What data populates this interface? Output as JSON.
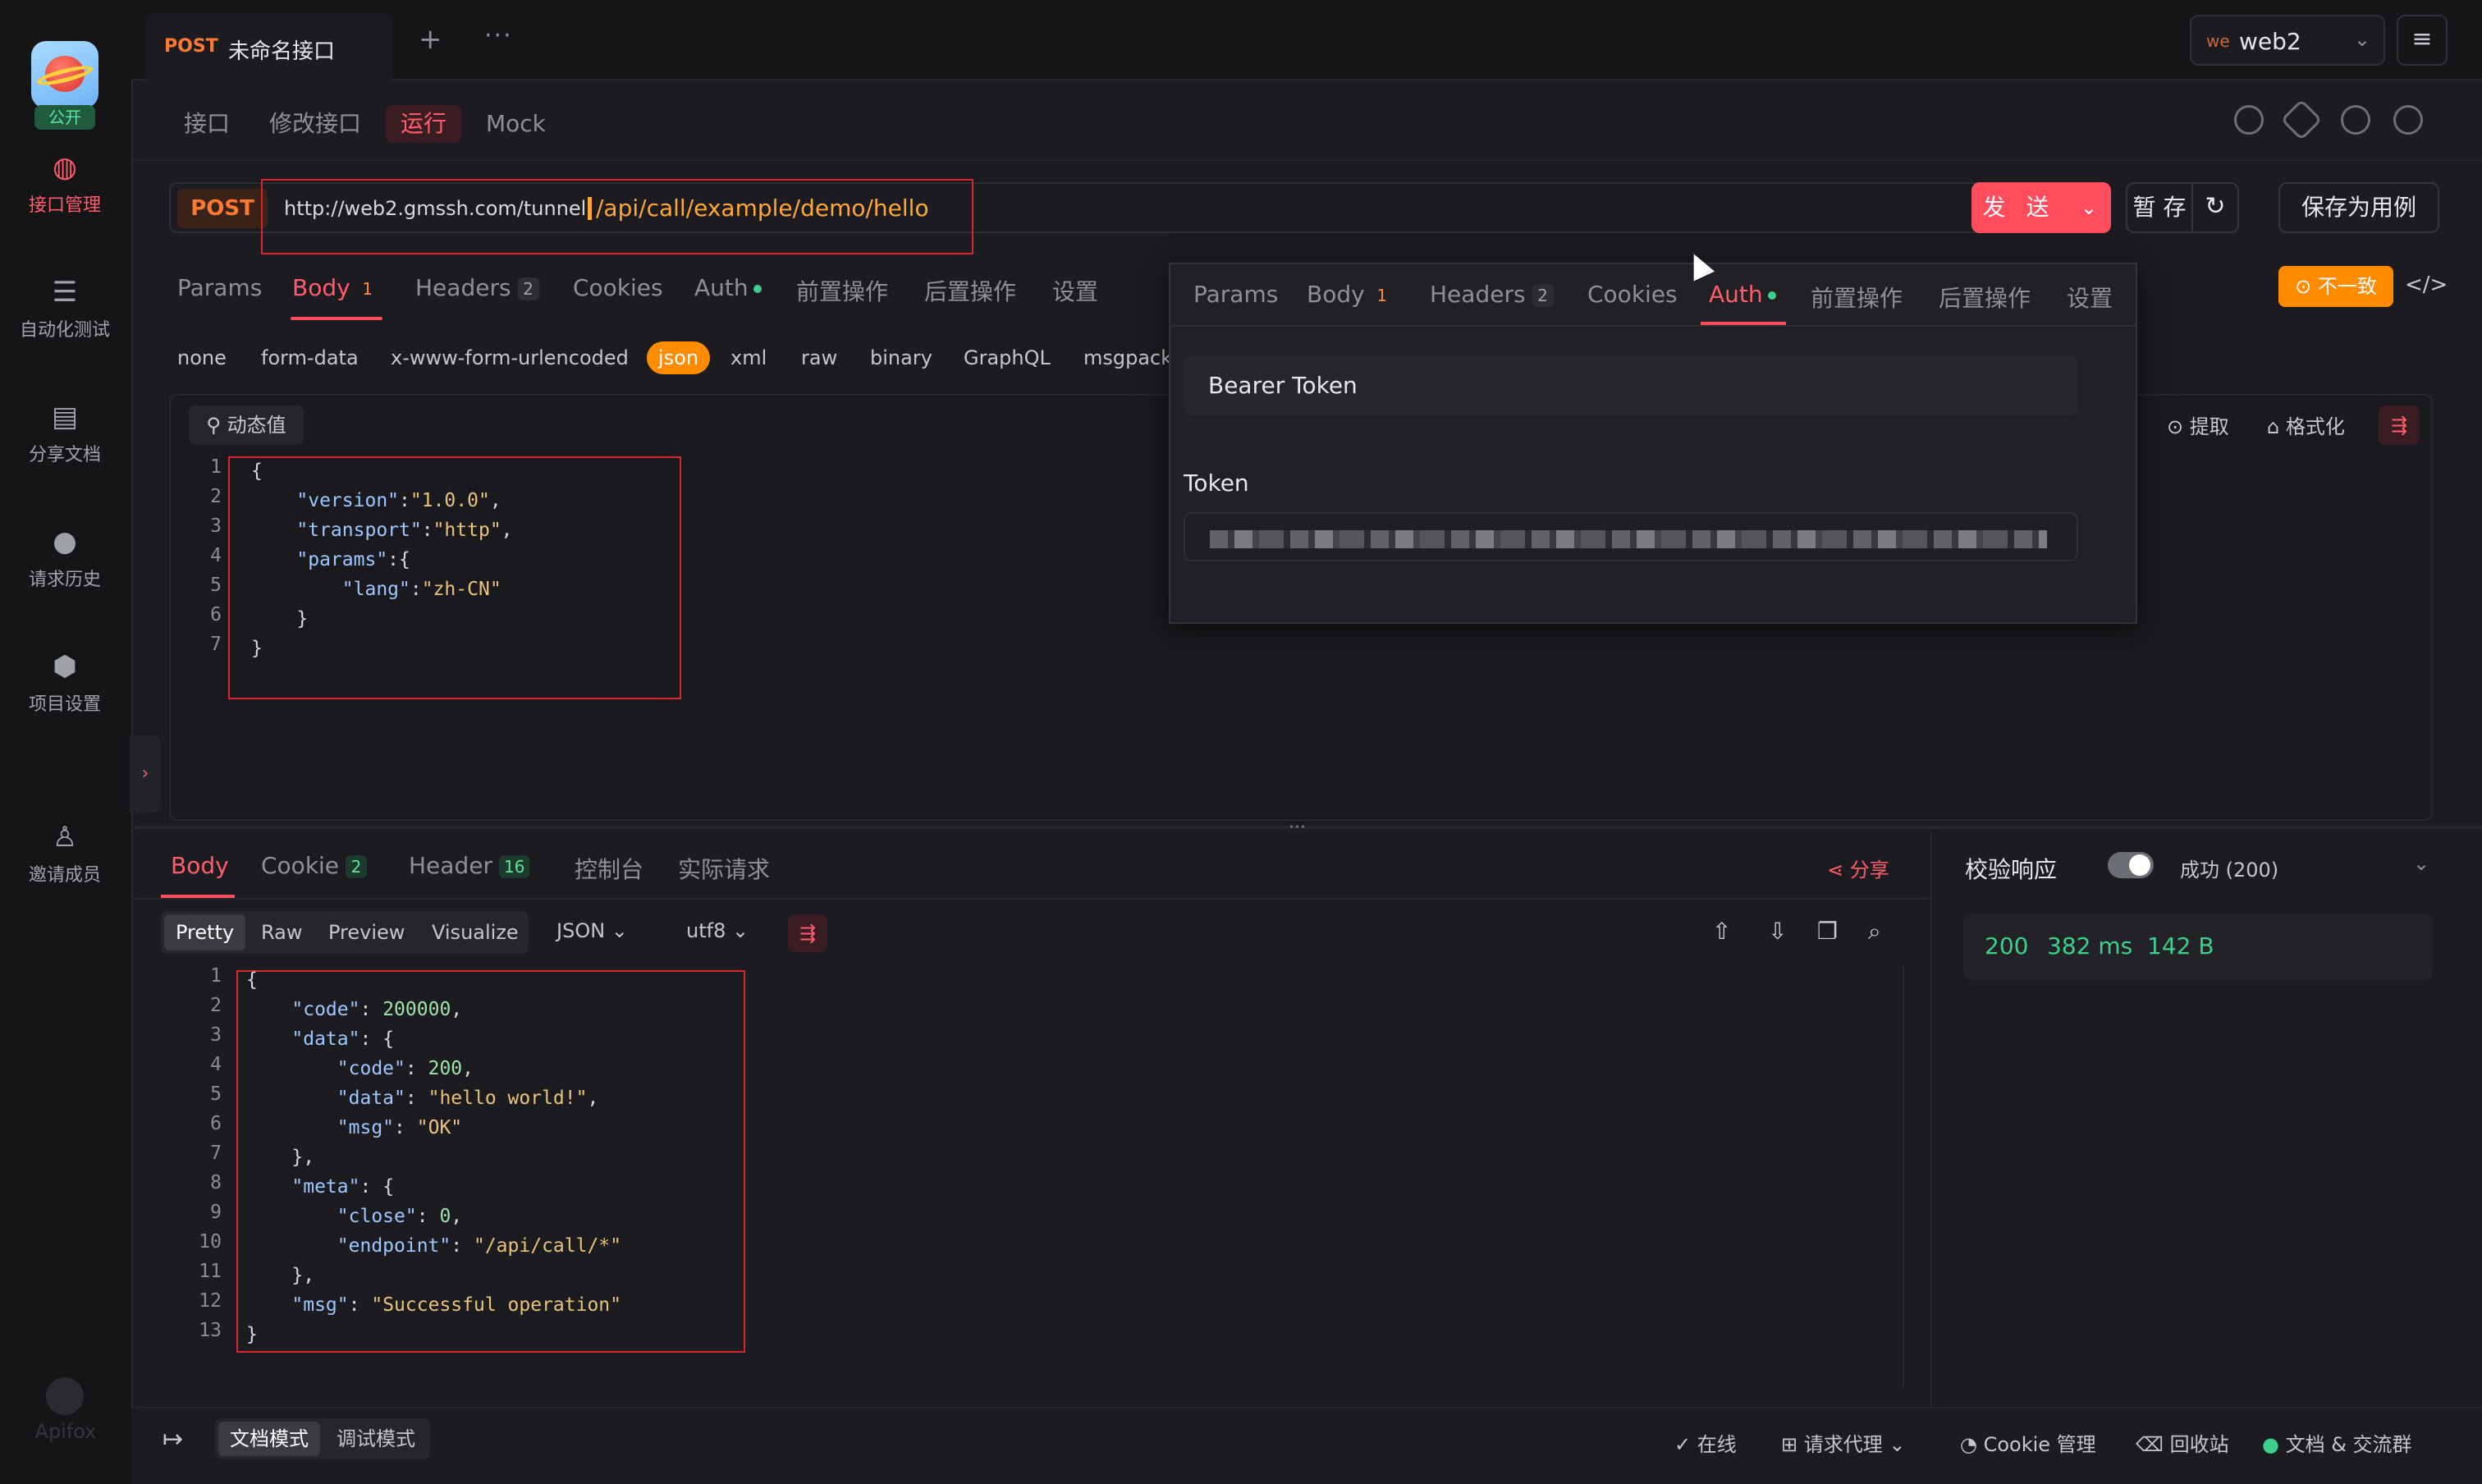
{
  "sidebar": {
    "public_badge": "公开",
    "items": [
      {
        "label": "接口管理",
        "icon": "api-management-icon"
      },
      {
        "label": "自动化测试",
        "icon": "automation-test-icon"
      },
      {
        "label": "分享文档",
        "icon": "share-doc-icon"
      },
      {
        "label": "请求历史",
        "icon": "history-icon"
      },
      {
        "label": "项目设置",
        "icon": "settings-icon"
      },
      {
        "label": "邀请成员",
        "icon": "invite-member-icon"
      }
    ],
    "brand": "Apifox"
  },
  "tab": {
    "method": "POST",
    "title": "未命名接口"
  },
  "env": {
    "prefix": "we",
    "name": "web2"
  },
  "subtabs": [
    "接口",
    "修改接口",
    "运行",
    "Mock"
  ],
  "request": {
    "method": "POST",
    "base_url": "http://web2.gmssh.com/tunnel",
    "path": "/api/call/example/demo/hello",
    "send": "发 送",
    "stage": "暂 存",
    "save_as_case": "保存为用例",
    "mismatch": "不一致"
  },
  "req_tabs": [
    {
      "label": "Params"
    },
    {
      "label": "Body",
      "badge": "1"
    },
    {
      "label": "Headers",
      "badge": "2"
    },
    {
      "label": "Cookies"
    },
    {
      "label": "Auth"
    },
    {
      "label": "前置操作"
    },
    {
      "label": "后置操作"
    },
    {
      "label": "设置"
    }
  ],
  "body_types": [
    "none",
    "form-data",
    "x-www-form-urlencoded",
    "json",
    "xml",
    "raw",
    "binary",
    "GraphQL",
    "msgpack"
  ],
  "editor": {
    "dynamic_value": "动态值",
    "extract": "提取",
    "format": "格式化",
    "lines": [
      "{",
      "    \"version\":\"1.0.0\",",
      "    \"transport\":\"http\",",
      "    \"params\":{",
      "        \"lang\":\"zh-CN\"",
      "    }",
      "}"
    ]
  },
  "auth_popover": {
    "tabs": [
      {
        "label": "Params"
      },
      {
        "label": "Body",
        "badge": "1"
      },
      {
        "label": "Headers",
        "badge": "2"
      },
      {
        "label": "Cookies"
      },
      {
        "label": "Auth"
      },
      {
        "label": "前置操作"
      },
      {
        "label": "后置操作"
      },
      {
        "label": "设置"
      }
    ],
    "type": "Bearer Token",
    "token_label": "Token"
  },
  "response": {
    "tabs": [
      {
        "label": "Body"
      },
      {
        "label": "Cookie",
        "badge": "2"
      },
      {
        "label": "Header",
        "badge": "16"
      },
      {
        "label": "控制台"
      },
      {
        "label": "实际请求"
      }
    ],
    "share": "分享",
    "formats": [
      "Pretty",
      "Raw",
      "Preview",
      "Visualize"
    ],
    "lang": "JSON",
    "encoding": "utf8",
    "lines": [
      "{",
      "    \"code\": 200000,",
      "    \"data\": {",
      "        \"code\": 200,",
      "        \"data\": \"hello world!\",",
      "        \"msg\": \"OK\"",
      "    },",
      "    \"meta\": {",
      "        \"close\": 0,",
      "        \"endpoint\": \"/api/call/*\"",
      "    },",
      "    \"msg\": \"Successful operation\"",
      "}"
    ]
  },
  "verify": {
    "label": "校验响应",
    "status": "成功 (200)",
    "code": "200",
    "time": "382 ms",
    "size": "142 B"
  },
  "statusbar": {
    "modes": [
      "文档模式",
      "调试模式"
    ],
    "online": "在线",
    "proxy": "请求代理",
    "cookie": "Cookie 管理",
    "trash": "回收站",
    "docs": "文档 & 交流群"
  }
}
